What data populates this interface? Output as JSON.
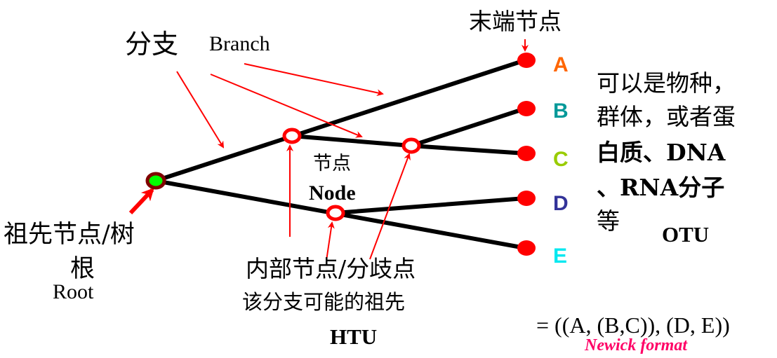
{
  "labels": {
    "branch_cn": "分支",
    "branch_en": "Branch",
    "terminal_node": "末端节点",
    "node_cn": "节点",
    "node_en": "Node",
    "root_cn_line1": "祖先节点/树",
    "root_cn_line2": "根",
    "root_en": "Root",
    "internal_line1": "内部节点/分歧点",
    "internal_line2": "该分支可能的祖先",
    "htu": "HTU",
    "otu_desc": [
      "可以是物种，",
      "群体，或者蛋",
      "白质、DNA",
      "、RNA分子",
      "等"
    ],
    "otu": "OTU",
    "newick": "= ((A, (B,C)), (D, E))",
    "newick_caption": "Newick format"
  },
  "tips": [
    {
      "label": "A",
      "color": "#ff6600"
    },
    {
      "label": "B",
      "color": "#009999"
    },
    {
      "label": "C",
      "color": "#99cc00"
    },
    {
      "label": "D",
      "color": "#333399"
    },
    {
      "label": "E",
      "color": "#00ffff"
    }
  ],
  "colors": {
    "arrow": "#ff0000",
    "tip_node": "#ff0000",
    "root_fill": "#00ff00",
    "root_ring": "#800000",
    "caption": "#ff0066"
  }
}
